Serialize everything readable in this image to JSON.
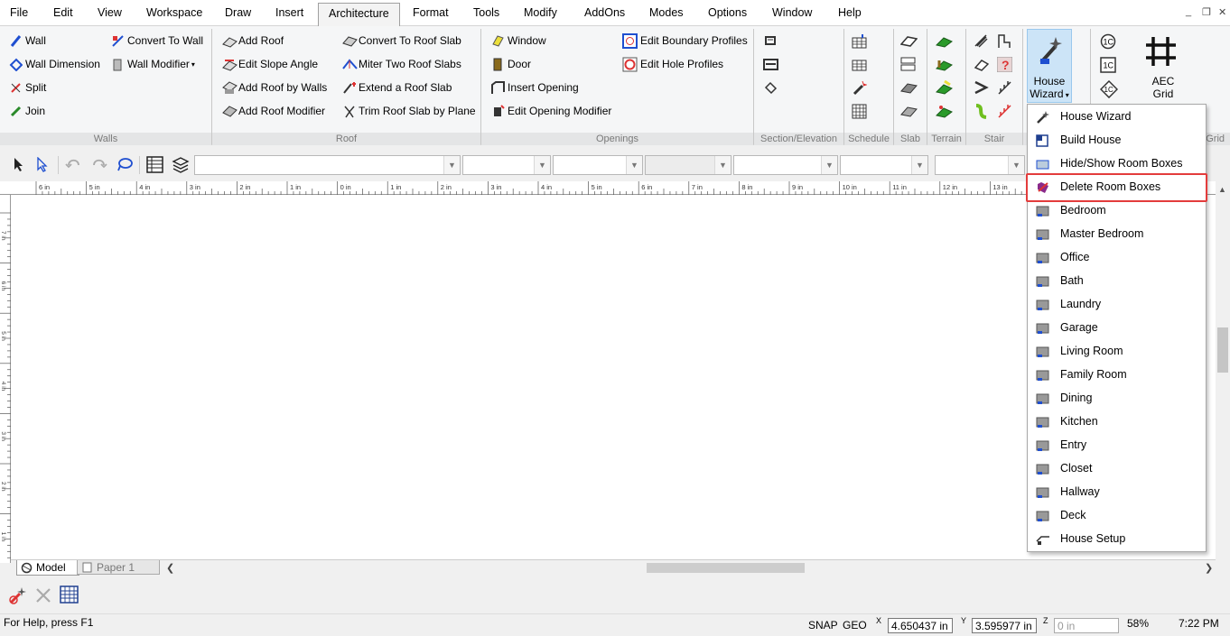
{
  "menu": {
    "items": [
      "File",
      "Edit",
      "View",
      "Workspace",
      "Draw",
      "Insert",
      "Architecture",
      "Format",
      "Tools",
      "Modify",
      "AddOns",
      "Modes",
      "Options",
      "Window",
      "Help"
    ],
    "active": "Architecture"
  },
  "window_controls": {
    "minimize": "_",
    "restore": "❐",
    "close": "✕"
  },
  "ribbon": {
    "walls": {
      "label": "Walls",
      "wall": "Wall",
      "wall_dimension": "Wall Dimension",
      "split": "Split",
      "join": "Join",
      "convert_to_wall": "Convert To Wall",
      "wall_modifier": "Wall Modifier"
    },
    "roof": {
      "label": "Roof",
      "add_roof": "Add Roof",
      "edit_slope_angle": "Edit Slope Angle",
      "add_roof_by_walls": "Add Roof by Walls",
      "add_roof_modifier": "Add Roof Modifier",
      "convert_to_roof_slab": "Convert To Roof Slab",
      "miter_two_roof_slabs": "Miter Two Roof Slabs",
      "extend_a_roof_slab": "Extend a Roof Slab",
      "trim_roof_slab_by_plane": "Trim Roof Slab by Plane"
    },
    "openings": {
      "label": "Openings",
      "window": "Window",
      "door": "Door",
      "insert_opening": "Insert Opening",
      "edit_opening_modifier": "Edit Opening Modifier",
      "edit_boundary_profiles": "Edit Boundary Profiles",
      "edit_hole_profiles": "Edit Hole Profiles"
    },
    "section_elevation": {
      "label": "Section/Elevation"
    },
    "schedule": {
      "label": "Schedule"
    },
    "slab": {
      "label": "Slab"
    },
    "terrain": {
      "label": "Terrain"
    },
    "stair": {
      "label": "Stair"
    },
    "house_wizard": {
      "line1": "House",
      "line2": "Wizard"
    },
    "aec_grid": {
      "line1": "AEC",
      "line2": "Grid",
      "group_label": "Grid"
    }
  },
  "ruler": {
    "labels": [
      "6 in",
      "5 in",
      "4 in",
      "3 in",
      "2 in",
      "1 in",
      "0 in",
      "1 in",
      "2 in",
      "3 in",
      "4 in",
      "5 in",
      "6 in",
      "7 in",
      "8 in",
      "9 in",
      "10 in",
      "11 in",
      "12 in",
      "13 in"
    ],
    "v_labels": [
      "7 in",
      "6 in",
      "5 in",
      "4 in",
      "3 in",
      "2 in",
      "1 in"
    ]
  },
  "dropdown": {
    "items": [
      "House Wizard",
      "Build House",
      "Hide/Show Room Boxes",
      "Delete Room Boxes",
      "Bedroom",
      "Master Bedroom",
      "Office",
      "Bath",
      "Laundry",
      "Garage",
      "Living Room",
      "Family Room",
      "Dining",
      "Kitchen",
      "Entry",
      "Closet",
      "Hallway",
      "Deck",
      "House Setup"
    ],
    "highlighted": "Delete Room Boxes"
  },
  "tabs": {
    "model": "Model",
    "paper": "Paper 1"
  },
  "status": {
    "help": "For Help, press F1",
    "snap": "SNAP",
    "geo": "GEO",
    "x_label": "X",
    "x": "4.650437 in",
    "y_label": "Y",
    "y": "3.595977 in",
    "z_label": "Z",
    "z": "0 in",
    "zoom": "58%",
    "time": "7:22 PM"
  },
  "colors": {
    "accent": "#e33c3c",
    "blue": "#1f4fd0",
    "ribbon_bg": "#f5f6f7",
    "hw_bg": "#cce4f7"
  }
}
